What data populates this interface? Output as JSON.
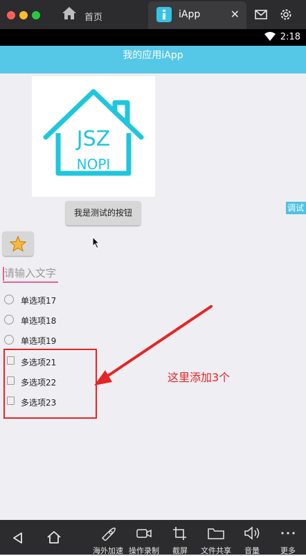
{
  "browser": {
    "tabs": [
      {
        "label": "首页",
        "icon": "home-icon"
      },
      {
        "label": "iApp",
        "icon": "iapp-icon",
        "active": true
      }
    ],
    "toolbar_icons": [
      "mail-icon",
      "gear-icon"
    ],
    "colors": {
      "bar": "#2c2c2e",
      "close": "#ff5f57",
      "minimize": "#ffbd2e",
      "maximize": "#28c840"
    }
  },
  "status": {
    "time": "2:18",
    "wifi_icon": "wifi-icon"
  },
  "app": {
    "title": "我的应用iApp",
    "logo_line1": "JSZ",
    "logo_line2": "NOPI",
    "test_button": "我是测试的按钮",
    "debug_tag": "调试",
    "star_icon": "star-icon",
    "input": {
      "placeholder": "请输入文字",
      "value": ""
    },
    "radios": [
      {
        "label": "单选项17"
      },
      {
        "label": "单选项18"
      },
      {
        "label": "单选项19"
      }
    ],
    "checkboxes": [
      {
        "label": "多选项21"
      },
      {
        "label": "多选项22"
      },
      {
        "label": "多选项23"
      }
    ],
    "annotation": "这里添加3个",
    "accent": "#55c7e7",
    "annotation_color": "#e32525"
  },
  "bottom_nav": {
    "items": [
      {
        "label": "海外加速",
        "icon": "rocket-icon"
      },
      {
        "label": "操作录制",
        "icon": "record-icon"
      },
      {
        "label": "截屏",
        "icon": "crop-icon"
      },
      {
        "label": "文件共享",
        "icon": "folder-icon"
      },
      {
        "label": "音量",
        "icon": "volume-icon"
      },
      {
        "label": "更多",
        "icon": "more-icon"
      }
    ],
    "back_icon": "back-icon",
    "home_icon": "home-icon"
  }
}
